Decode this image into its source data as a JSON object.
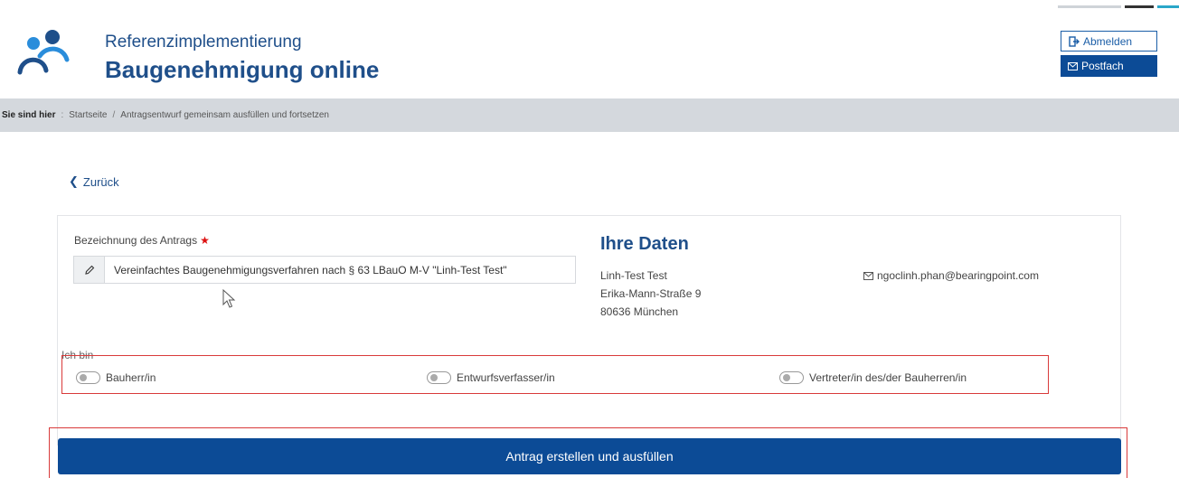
{
  "header": {
    "subtitle": "Referenzimplementierung",
    "title": "Baugenehmigung online",
    "logout_label": "Abmelden",
    "inbox_label": "Postfach"
  },
  "breadcrumb": {
    "label": "Sie sind hier",
    "separator1": ":",
    "home": "Startseite",
    "separator2": "/",
    "current": "Antragsentwurf gemeinsam ausfüllen und fortsetzen"
  },
  "back": {
    "label": "Zurück"
  },
  "form": {
    "field_label": "Bezeichnung des Antrags",
    "required_marker": "★",
    "field_value": "Vereinfachtes Baugenehmigungsverfahren nach § 63 LBauO M-V \"Linh-Test Test\""
  },
  "user_data": {
    "title": "Ihre Daten",
    "name": "Linh-Test Test",
    "street": "Erika-Mann-Straße 9",
    "city": "80636 München",
    "email": "ngoclinh.phan@bearingpoint.com"
  },
  "roles": {
    "label": "Ich bin",
    "options": [
      {
        "label": "Bauherr/in",
        "checked": false
      },
      {
        "label": "Entwurfsverfasser/in",
        "checked": false
      },
      {
        "label": "Vertreter/in des/der Bauherren/in",
        "checked": false
      }
    ]
  },
  "submit": {
    "label": "Antrag erstellen und ausfüllen"
  },
  "colors": {
    "brand_blue": "#1f4f8a",
    "button_blue": "#0c4b96",
    "highlight_red": "#d93a3a"
  }
}
